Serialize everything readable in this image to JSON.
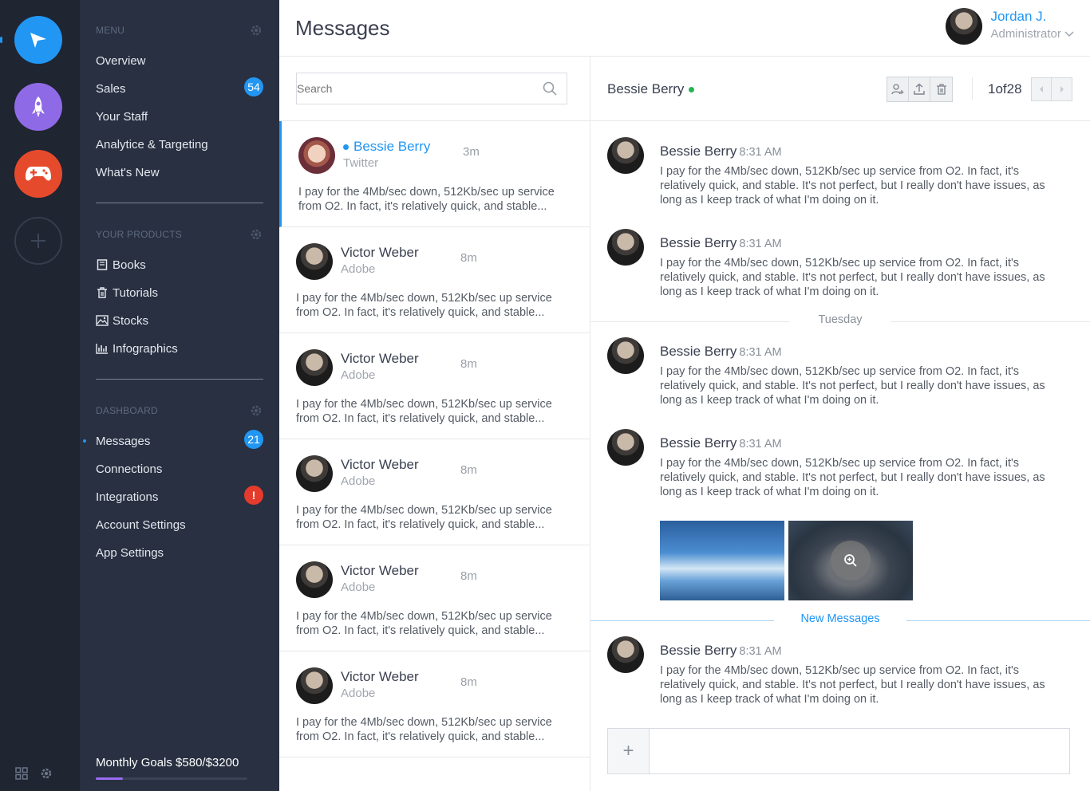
{
  "rail": {
    "apps": [
      {
        "name": "send-app",
        "color": "#2196f3"
      },
      {
        "name": "rocket-app",
        "color": "#8f6ae6"
      },
      {
        "name": "game-app",
        "color": "#e64a2d"
      }
    ]
  },
  "menu": {
    "menu_section": "MENU",
    "menu_items": [
      "Overview",
      "Sales",
      "Your Staff",
      "Analytice & Targeting",
      "What's New"
    ],
    "sales_badge": "54",
    "products_section": "YOUR PRODUCTS",
    "product_items": [
      "Books",
      "Tutorials",
      "Stocks",
      "Infographics"
    ],
    "dashboard_section": "DASHBOARD",
    "dashboard_items": [
      "Messages",
      "Connections",
      "Integrations",
      "Account Settings",
      "App Settings"
    ],
    "messages_badge": "21",
    "integrations_badge": "!",
    "goals_label": "Monthly Goals $580/$3200",
    "goals_progress": 0.18
  },
  "header": {
    "title": "Messages",
    "user_name": "Jordan J.",
    "user_role": "Administrator"
  },
  "list": {
    "search_placeholder": "Search",
    "items": [
      {
        "name": "Bessie Berry",
        "source": "Twitter",
        "time": "3m",
        "preview": "I pay for the 4Mb/sec down, 512Kb/sec up service from O2. In fact, it's relatively quick, and stable..."
      },
      {
        "name": "Victor Weber",
        "source": "Adobe",
        "time": "8m",
        "preview": "I pay for the 4Mb/sec down, 512Kb/sec up service from O2. In fact, it's relatively quick, and stable..."
      },
      {
        "name": "Victor Weber",
        "source": "Adobe",
        "time": "8m",
        "preview": "I pay for the 4Mb/sec down, 512Kb/sec up service from O2. In fact, it's relatively quick, and stable..."
      },
      {
        "name": "Victor Weber",
        "source": "Adobe",
        "time": "8m",
        "preview": "I pay for the 4Mb/sec down, 512Kb/sec up service from O2. In fact, it's relatively quick, and stable..."
      },
      {
        "name": "Victor Weber",
        "source": "Adobe",
        "time": "8m",
        "preview": "I pay for the 4Mb/sec down, 512Kb/sec up service from O2. In fact, it's relatively quick, and stable..."
      },
      {
        "name": "Victor Weber",
        "source": "Adobe",
        "time": "8m",
        "preview": "I pay for the 4Mb/sec down, 512Kb/sec up service from O2. In fact, it's relatively quick, and stable..."
      }
    ]
  },
  "conversation": {
    "contact_name": "Bessie Berry",
    "pager": "1of28",
    "day_separator": "Tuesday",
    "new_separator": "New Messages",
    "messages": [
      {
        "author": "Bessie Berry",
        "time": "8:31 AM",
        "text": "I pay for the 4Mb/sec down, 512Kb/sec up service from O2. In fact, it's relatively quick, and stable. It's not perfect, but I really don't have issues, as long as I keep track of what I'm doing on it."
      },
      {
        "author": "Bessie Berry",
        "time": "8:31 AM",
        "text": "I pay for the 4Mb/sec down, 512Kb/sec up service from O2. In fact, it's relatively quick, and stable. It's not perfect, but I really don't have issues, as long as I keep track of what I'm doing on it."
      },
      {
        "author": "Bessie Berry",
        "time": "8:31 AM",
        "text": "I pay for the 4Mb/sec down, 512Kb/sec up service from O2. In fact, it's relatively quick, and stable. It's not perfect, but I really don't have issues, as long as I keep track of what I'm doing on it."
      },
      {
        "author": "Bessie Berry",
        "time": "8:31 AM",
        "text": "I pay for the 4Mb/sec down, 512Kb/sec up service from O2. In fact, it's relatively quick, and stable. It's not perfect, but I really don't have issues, as long as I keep track of what I'm doing on it."
      },
      {
        "author": "Bessie Berry",
        "time": "8:31 AM",
        "text": "I pay for the 4Mb/sec down, 512Kb/sec up service from O2. In fact, it's relatively quick, and stable. It's not perfect, but I really don't have issues, as long as I keep track of what I'm doing on it."
      }
    ],
    "composer_plus": "+"
  },
  "colors": {
    "accent": "#2196f3",
    "online": "#25b455",
    "alert": "#e53b2c",
    "progress": "#9b6cf0"
  }
}
